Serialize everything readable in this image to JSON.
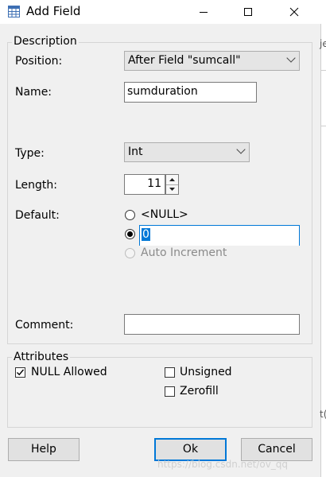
{
  "window": {
    "title": "Add Field"
  },
  "description": {
    "legend": "Description",
    "position_label": "Position:",
    "position_value": "After Field \"sumcall\"",
    "name_label": "Name:",
    "name_value": "sumduration",
    "type_label": "Type:",
    "type_value": "Int",
    "length_label": "Length:",
    "length_value": "11",
    "default_label": "Default:",
    "default_options": {
      "null_label": "<NULL>",
      "custom_value": "0",
      "auto_increment_label": "Auto Increment"
    },
    "comment_label": "Comment:",
    "comment_value": ""
  },
  "attributes": {
    "legend": "Attributes",
    "null_allowed_label": "NULL Allowed",
    "null_allowed_checked": true,
    "unsigned_label": "Unsigned",
    "unsigned_checked": false,
    "zerofill_label": "Zerofill",
    "zerofill_checked": false
  },
  "buttons": {
    "help": "Help",
    "ok": "Ok",
    "cancel": "Cancel"
  },
  "background_fragments": {
    "text1": "je",
    "text2": "t("
  },
  "watermark": "https://blog.csdn.net/ov_qq",
  "icons": {
    "app": "table-icon",
    "minimize": "minimize-icon",
    "maximize": "maximize-icon",
    "close": "close-icon",
    "dropdown": "chevron-down-icon",
    "spin_up": "triangle-up-icon",
    "spin_down": "triangle-down-icon"
  },
  "colors": {
    "dialog_bg": "#f0f0f0",
    "default_button_border": "#0078d7",
    "selection_highlight": "#0078d7"
  }
}
